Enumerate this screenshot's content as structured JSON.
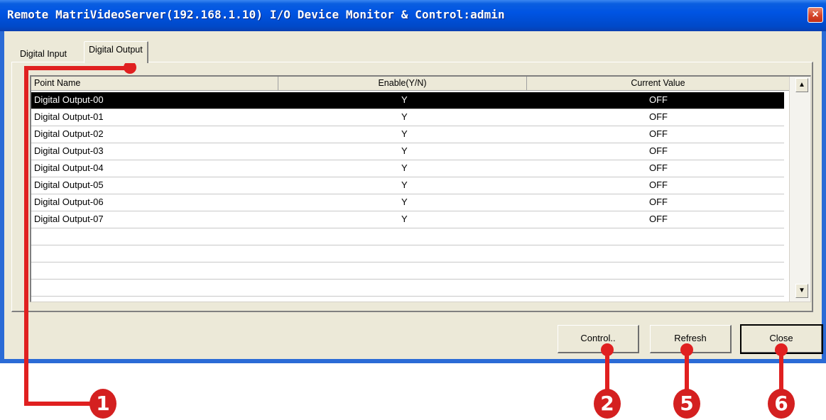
{
  "window": {
    "title": "Remote MatriVideoServer(192.168.1.10) I/O Device Monitor & Control:admin",
    "close_glyph": "×"
  },
  "tabs": [
    {
      "label": "Digital Input",
      "active": false
    },
    {
      "label": "Digital Output",
      "active": true
    }
  ],
  "table": {
    "columns": [
      "Point Name",
      "Enable(Y/N)",
      "Current Value"
    ],
    "rows": [
      {
        "name": "Digital Output-00",
        "enable": "Y",
        "value": "OFF",
        "selected": true
      },
      {
        "name": "Digital Output-01",
        "enable": "Y",
        "value": "OFF"
      },
      {
        "name": "Digital Output-02",
        "enable": "Y",
        "value": "OFF"
      },
      {
        "name": "Digital Output-03",
        "enable": "Y",
        "value": "OFF"
      },
      {
        "name": "Digital Output-04",
        "enable": "Y",
        "value": "OFF"
      },
      {
        "name": "Digital Output-05",
        "enable": "Y",
        "value": "OFF"
      },
      {
        "name": "Digital Output-06",
        "enable": "Y",
        "value": "OFF"
      },
      {
        "name": "Digital Output-07",
        "enable": "Y",
        "value": "OFF"
      }
    ]
  },
  "scrollbar": {
    "up_glyph": "▲",
    "down_glyph": "▼"
  },
  "buttons": {
    "control": "Control..",
    "refresh": "Refresh",
    "close": "Close"
  },
  "annotations": {
    "badge_1": "1",
    "badge_2": "2",
    "badge_5": "5",
    "badge_6": "6",
    "color": "#e02020"
  },
  "colors": {
    "titlebar": "#0054e3",
    "dialog_bg": "#ece9d8",
    "selection": "#000000"
  }
}
